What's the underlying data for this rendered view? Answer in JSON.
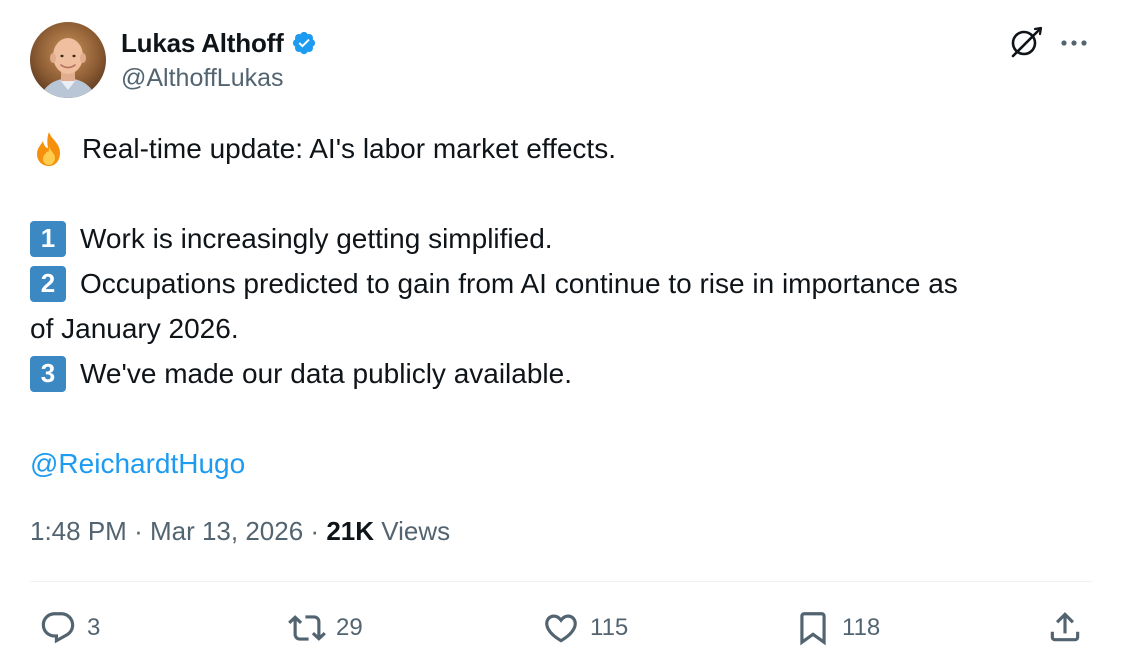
{
  "author": {
    "display_name": "Lukas Althoff",
    "handle": "@AlthoffLukas",
    "verified": true
  },
  "tweet": {
    "intro": "Real-time update: AI's labor market effects.",
    "points": [
      {
        "number": "1",
        "text": "Work is increasingly getting simplified."
      },
      {
        "number": "2",
        "text": "Occupations predicted to gain from AI continue to rise in importance as",
        "continuation": "of January 2026."
      },
      {
        "number": "3",
        "text": "We've made our data publicly available."
      }
    ],
    "mention": "@ReichardtHugo"
  },
  "meta": {
    "time": "1:48 PM",
    "separator": "·",
    "date": "Mar 13, 2026",
    "views_count": "21K",
    "views_label": "Views"
  },
  "actions": {
    "replies": "3",
    "reposts": "29",
    "likes": "115",
    "bookmarks": "118"
  },
  "colors": {
    "text": "#0f1419",
    "secondary": "#536471",
    "link": "#1d9bf0",
    "verified": "#1d9bf0",
    "keycap": "#3b88c3",
    "divider": "#eff3f4"
  },
  "icons": [
    "verified-badge-icon",
    "grok-icon",
    "more-icon",
    "fire-emoji",
    "keycap-1",
    "keycap-2",
    "keycap-3",
    "reply-icon",
    "repost-icon",
    "like-icon",
    "bookmark-icon",
    "share-icon"
  ]
}
